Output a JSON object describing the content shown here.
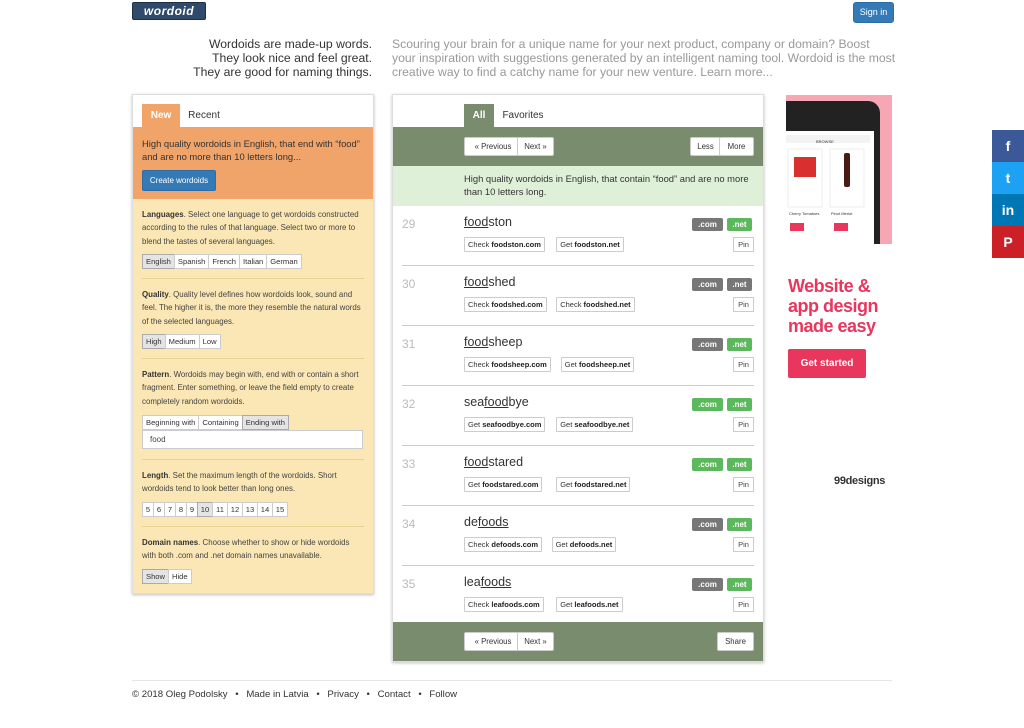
{
  "header": {
    "logo": "wordoid",
    "signin": "Sign in"
  },
  "tagline": [
    "Wordoids are made-up words.",
    "They look nice and feel great.",
    "They are good for naming things."
  ],
  "intro": "Scouring your brain for a unique name for your next product, company or domain? Boost your inspiration with suggestions generated by an intelligent naming tool. Wordoid is the most creative way to find a catchy name for your new venture. Learn more...",
  "left": {
    "tabs": [
      "New",
      "Recent"
    ],
    "desc": "High quality wordoids in English, that end with “food” and are no more than 10 letters long...",
    "create": "Create wordoids",
    "languages": {
      "title": "Languages",
      "text": ". Select one language to get wordoids constructed according to the rules of that language. Select two or more to blend the tastes of several languages.",
      "options": [
        "English",
        "Spanish",
        "French",
        "Italian",
        "German"
      ]
    },
    "quality": {
      "title": "Quality",
      "text": ". Quality level defines how wordoids look, sound and feel. The higher it is, the more they resemble the natural words of the selected languages.",
      "options": [
        "High",
        "Medium",
        "Low"
      ]
    },
    "pattern": {
      "title": "Pattern",
      "text": ". Wordoids may begin with, end with or contain a short fragment. Enter something, or leave the field empty to create completely random wordoids.",
      "options": [
        "Beginning with",
        "Containing",
        "Ending with"
      ],
      "value": "food"
    },
    "length": {
      "title": "Length",
      "text": ". Set the maximum length of the wordoids. Short wordoids tend to look better than long ones.",
      "options": [
        "5",
        "6",
        "7",
        "8",
        "9",
        "10",
        "11",
        "12",
        "13",
        "14",
        "15"
      ]
    },
    "domains": {
      "title": "Domain names",
      "text": ". Choose whether to show or hide wordoids with both .com and .net domain names unavailable.",
      "options": [
        "Show",
        "Hide"
      ]
    }
  },
  "center": {
    "tabs": [
      "All",
      "Favorites"
    ],
    "prev": "« Previous",
    "next": "Next »",
    "less": "Less",
    "more": "More",
    "share": "Share",
    "desc": "High quality wordoids in English, that contain “food” and are no more than 10 letters long.",
    "com": ".com",
    "net": ".net",
    "pin": "Pin",
    "rows": [
      {
        "num": "29",
        "pre": "",
        "hl": "food",
        "post": "ston",
        "a_verb": "Check",
        "a_dom": "foodston.com",
        "b_verb": "Get",
        "b_dom": "foodston.net"
      },
      {
        "num": "30",
        "pre": "",
        "hl": "food",
        "post": "shed",
        "a_verb": "Check",
        "a_dom": "foodshed.com",
        "b_verb": "Check",
        "b_dom": "foodshed.net"
      },
      {
        "num": "31",
        "pre": "",
        "hl": "food",
        "post": "sheep",
        "a_verb": "Check",
        "a_dom": "foodsheep.com",
        "b_verb": "Get",
        "b_dom": "foodsheep.net"
      },
      {
        "num": "32",
        "pre": "sea",
        "hl": "food",
        "post": "bye",
        "a_verb": "Get",
        "a_dom": "seafoodbye.com",
        "b_verb": "Get",
        "b_dom": "seafoodbye.net"
      },
      {
        "num": "33",
        "pre": "",
        "hl": "food",
        "post": "stared",
        "a_verb": "Get",
        "a_dom": "foodstared.com",
        "b_verb": "Get",
        "b_dom": "foodstared.net"
      },
      {
        "num": "34",
        "pre": "de",
        "hl": "foods",
        "post": "",
        "a_verb": "Check",
        "a_dom": "defoods.com",
        "b_verb": "Get",
        "b_dom": "defoods.net"
      },
      {
        "num": "35",
        "pre": "lea",
        "hl": "foods",
        "post": "",
        "a_verb": "Check",
        "a_dom": "leafoods.com",
        "b_verb": "Get",
        "b_dom": "leafoods.net"
      }
    ]
  },
  "ad": {
    "phone_label": "BROWSE",
    "items": [
      "Cherry Tomatoes",
      "Pinot Merlot"
    ],
    "title": [
      "Website &",
      "app design",
      "made easy"
    ],
    "button": "Get started",
    "brand": "99designs"
  },
  "social": {
    "facebook": "f",
    "twitter": "t",
    "linkedin": "in",
    "pinterest": "P"
  },
  "footer": {
    "copyright": "© 2018 Oleg Podolsky",
    "made": "Made in Latvia",
    "privacy": "Privacy",
    "contact": "Contact",
    "follow": "Follow",
    "sep": "•"
  },
  "colors": {
    "orange": "#f0a46a",
    "cream": "#fbe7b5",
    "green_bar": "#7a8c6e",
    "mint": "#dff0d8",
    "free": "#5cb85c",
    "taken": "#777777",
    "brand_pink": "#e8365d"
  }
}
